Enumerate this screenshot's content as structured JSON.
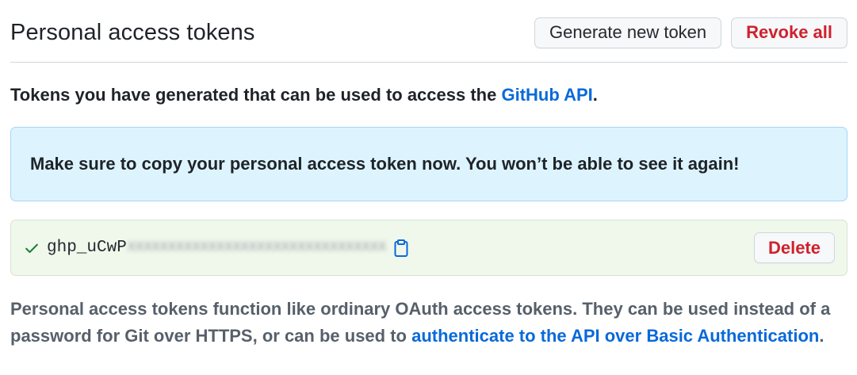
{
  "header": {
    "title": "Personal access tokens",
    "generate_label": "Generate new token",
    "revoke_label": "Revoke all"
  },
  "intro": {
    "text": "Tokens you have generated that can be used to access the ",
    "link": "GitHub API",
    "end": "."
  },
  "flash": {
    "message": "Make sure to copy your personal access token now. You won’t be able to see it again!"
  },
  "token": {
    "prefix": "ghp_uCwP",
    "masked": "XXXXXXXXXXXXXXXXXXXXXXXXXXXXXXXX",
    "delete_label": "Delete",
    "check_icon": "check-icon",
    "copy_icon": "clipboard-icon"
  },
  "footer": {
    "text": "Personal access tokens function like ordinary OAuth access tokens. They can be used instead of a password for Git over HTTPS, or can be used to ",
    "link": "authenticate to the API over Basic Authentication",
    "end": "."
  },
  "colors": {
    "link": "#0969da",
    "danger": "#cf222e",
    "flash_bg": "#ddf4ff",
    "token_bg": "#f0f8ec",
    "check": "#1a7f37"
  }
}
